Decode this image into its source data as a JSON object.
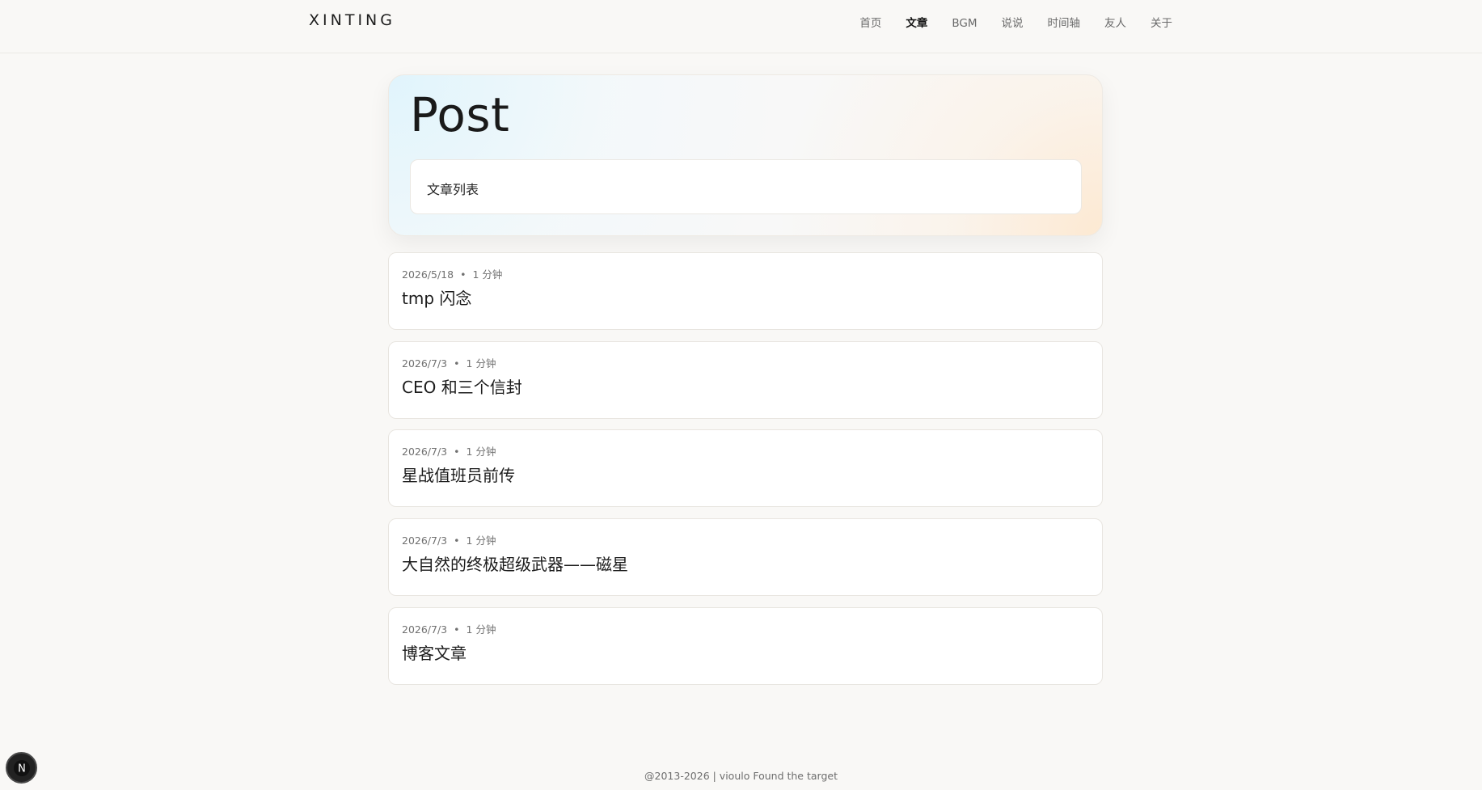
{
  "header": {
    "brand": "XINTING",
    "nav": [
      {
        "label": "首页",
        "active": false
      },
      {
        "label": "文章",
        "active": true
      },
      {
        "label": "BGM",
        "active": false
      },
      {
        "label": "说说",
        "active": false
      },
      {
        "label": "时间轴",
        "active": false
      },
      {
        "label": "友人",
        "active": false
      },
      {
        "label": "关于",
        "active": false
      }
    ]
  },
  "hero": {
    "title": "Post",
    "subtitle": "文章列表"
  },
  "posts": [
    {
      "date": "2026/5/18",
      "read_time": "1 分钟",
      "title": "tmp 闪念"
    },
    {
      "date": "2026/7/3",
      "read_time": "1 分钟",
      "title": "CEO 和三个信封"
    },
    {
      "date": "2026/7/3",
      "read_time": "1 分钟",
      "title": "星战值班员前传"
    },
    {
      "date": "2026/7/3",
      "read_time": "1 分钟",
      "title": "大自然的终极超级武器——磁星"
    },
    {
      "date": "2026/7/3",
      "read_time": "1 分钟",
      "title": "博客文章"
    }
  ],
  "meta_separator": "•",
  "footer": {
    "text": "@2013-2026 | vioulo Found the target"
  },
  "fab": {
    "icon": "next-n-icon",
    "glyph": "N"
  }
}
